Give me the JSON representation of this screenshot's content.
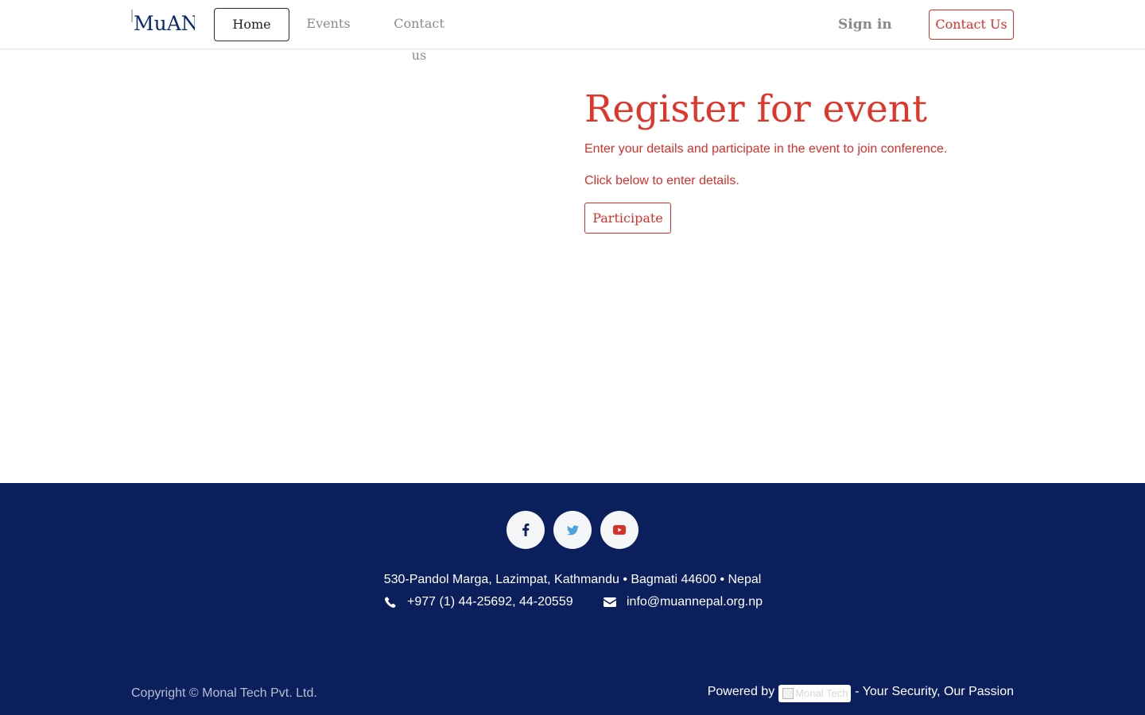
{
  "header": {
    "logo_alt": "MuAN",
    "nav": {
      "home": "Home",
      "events": "Events",
      "contact": "Contact us"
    },
    "signin": "Sign in",
    "contact_button": "Contact Us"
  },
  "main": {
    "title": "Register for event",
    "description": "Enter your details and participate in the event to join conference.",
    "instruction": "Click below to enter details.",
    "participate_button": "Participate"
  },
  "footer": {
    "social": [
      "facebook-icon",
      "twitter-icon",
      "youtube-icon"
    ],
    "address": "530-Pandol Marga, Lazimpat, Kathmandu • Bagmati 44600 • Nepal",
    "phone": "+977 (1) 44-25692, 44-20559",
    "email": "info@muannepal.org.np",
    "copyright": "Copyright © Monal Tech Pvt. Ltd.",
    "powered_prefix": "Powered by",
    "powered_logo_alt": "Monal Tech",
    "powered_suffix": "- Your Security, Our Passion"
  },
  "colors": {
    "accent": "#d9302a",
    "footer_bg": "#0a1f5c",
    "facebook": "#0a1f5c",
    "twitter": "#4da3e0",
    "youtube": "#d9302a"
  }
}
